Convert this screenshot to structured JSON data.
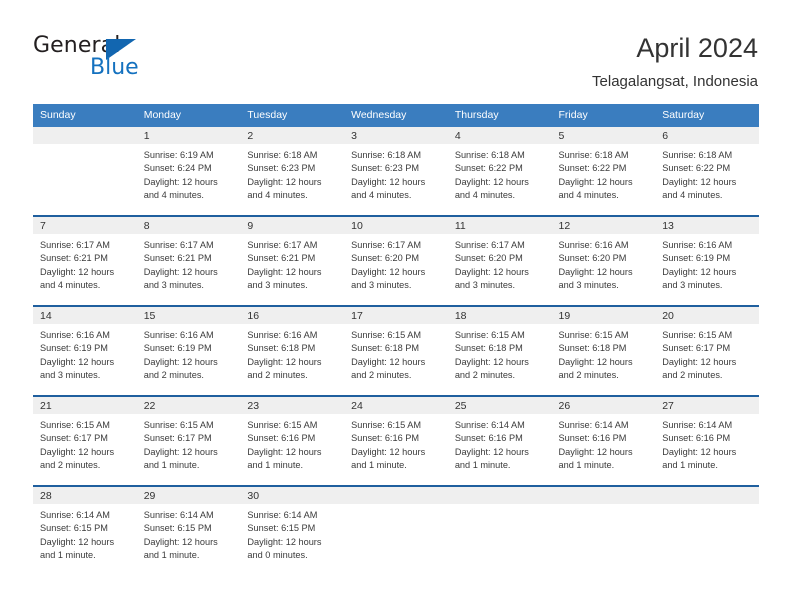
{
  "brand": {
    "name_part1": "General",
    "name_part2": "Blue",
    "triangle_color": "#1266b0",
    "blue_color": "#1471bf"
  },
  "header": {
    "title": "April 2024",
    "subtitle": "Telagalangsat, Indonesia"
  },
  "theme": {
    "header_row_bg": "#3a7dbf",
    "row_separator": "#1f5f9e",
    "daynum_strip_bg": "#efefef",
    "text": "#333333"
  },
  "weekday_headers": [
    "Sunday",
    "Monday",
    "Tuesday",
    "Wednesday",
    "Thursday",
    "Friday",
    "Saturday"
  ],
  "weeks": [
    [
      {
        "day": "",
        "sunrise": "",
        "sunset": "",
        "daylight1": "",
        "daylight2": "",
        "blank": true
      },
      {
        "day": "1",
        "sunrise": "Sunrise: 6:19 AM",
        "sunset": "Sunset: 6:24 PM",
        "daylight1": "Daylight: 12 hours",
        "daylight2": "and 4 minutes."
      },
      {
        "day": "2",
        "sunrise": "Sunrise: 6:18 AM",
        "sunset": "Sunset: 6:23 PM",
        "daylight1": "Daylight: 12 hours",
        "daylight2": "and 4 minutes."
      },
      {
        "day": "3",
        "sunrise": "Sunrise: 6:18 AM",
        "sunset": "Sunset: 6:23 PM",
        "daylight1": "Daylight: 12 hours",
        "daylight2": "and 4 minutes."
      },
      {
        "day": "4",
        "sunrise": "Sunrise: 6:18 AM",
        "sunset": "Sunset: 6:22 PM",
        "daylight1": "Daylight: 12 hours",
        "daylight2": "and 4 minutes."
      },
      {
        "day": "5",
        "sunrise": "Sunrise: 6:18 AM",
        "sunset": "Sunset: 6:22 PM",
        "daylight1": "Daylight: 12 hours",
        "daylight2": "and 4 minutes."
      },
      {
        "day": "6",
        "sunrise": "Sunrise: 6:18 AM",
        "sunset": "Sunset: 6:22 PM",
        "daylight1": "Daylight: 12 hours",
        "daylight2": "and 4 minutes."
      }
    ],
    [
      {
        "day": "7",
        "sunrise": "Sunrise: 6:17 AM",
        "sunset": "Sunset: 6:21 PM",
        "daylight1": "Daylight: 12 hours",
        "daylight2": "and 4 minutes."
      },
      {
        "day": "8",
        "sunrise": "Sunrise: 6:17 AM",
        "sunset": "Sunset: 6:21 PM",
        "daylight1": "Daylight: 12 hours",
        "daylight2": "and 3 minutes."
      },
      {
        "day": "9",
        "sunrise": "Sunrise: 6:17 AM",
        "sunset": "Sunset: 6:21 PM",
        "daylight1": "Daylight: 12 hours",
        "daylight2": "and 3 minutes."
      },
      {
        "day": "10",
        "sunrise": "Sunrise: 6:17 AM",
        "sunset": "Sunset: 6:20 PM",
        "daylight1": "Daylight: 12 hours",
        "daylight2": "and 3 minutes."
      },
      {
        "day": "11",
        "sunrise": "Sunrise: 6:17 AM",
        "sunset": "Sunset: 6:20 PM",
        "daylight1": "Daylight: 12 hours",
        "daylight2": "and 3 minutes."
      },
      {
        "day": "12",
        "sunrise": "Sunrise: 6:16 AM",
        "sunset": "Sunset: 6:20 PM",
        "daylight1": "Daylight: 12 hours",
        "daylight2": "and 3 minutes."
      },
      {
        "day": "13",
        "sunrise": "Sunrise: 6:16 AM",
        "sunset": "Sunset: 6:19 PM",
        "daylight1": "Daylight: 12 hours",
        "daylight2": "and 3 minutes."
      }
    ],
    [
      {
        "day": "14",
        "sunrise": "Sunrise: 6:16 AM",
        "sunset": "Sunset: 6:19 PM",
        "daylight1": "Daylight: 12 hours",
        "daylight2": "and 3 minutes."
      },
      {
        "day": "15",
        "sunrise": "Sunrise: 6:16 AM",
        "sunset": "Sunset: 6:19 PM",
        "daylight1": "Daylight: 12 hours",
        "daylight2": "and 2 minutes."
      },
      {
        "day": "16",
        "sunrise": "Sunrise: 6:16 AM",
        "sunset": "Sunset: 6:18 PM",
        "daylight1": "Daylight: 12 hours",
        "daylight2": "and 2 minutes."
      },
      {
        "day": "17",
        "sunrise": "Sunrise: 6:15 AM",
        "sunset": "Sunset: 6:18 PM",
        "daylight1": "Daylight: 12 hours",
        "daylight2": "and 2 minutes."
      },
      {
        "day": "18",
        "sunrise": "Sunrise: 6:15 AM",
        "sunset": "Sunset: 6:18 PM",
        "daylight1": "Daylight: 12 hours",
        "daylight2": "and 2 minutes."
      },
      {
        "day": "19",
        "sunrise": "Sunrise: 6:15 AM",
        "sunset": "Sunset: 6:18 PM",
        "daylight1": "Daylight: 12 hours",
        "daylight2": "and 2 minutes."
      },
      {
        "day": "20",
        "sunrise": "Sunrise: 6:15 AM",
        "sunset": "Sunset: 6:17 PM",
        "daylight1": "Daylight: 12 hours",
        "daylight2": "and 2 minutes."
      }
    ],
    [
      {
        "day": "21",
        "sunrise": "Sunrise: 6:15 AM",
        "sunset": "Sunset: 6:17 PM",
        "daylight1": "Daylight: 12 hours",
        "daylight2": "and 2 minutes."
      },
      {
        "day": "22",
        "sunrise": "Sunrise: 6:15 AM",
        "sunset": "Sunset: 6:17 PM",
        "daylight1": "Daylight: 12 hours",
        "daylight2": "and 1 minute."
      },
      {
        "day": "23",
        "sunrise": "Sunrise: 6:15 AM",
        "sunset": "Sunset: 6:16 PM",
        "daylight1": "Daylight: 12 hours",
        "daylight2": "and 1 minute."
      },
      {
        "day": "24",
        "sunrise": "Sunrise: 6:15 AM",
        "sunset": "Sunset: 6:16 PM",
        "daylight1": "Daylight: 12 hours",
        "daylight2": "and 1 minute."
      },
      {
        "day": "25",
        "sunrise": "Sunrise: 6:14 AM",
        "sunset": "Sunset: 6:16 PM",
        "daylight1": "Daylight: 12 hours",
        "daylight2": "and 1 minute."
      },
      {
        "day": "26",
        "sunrise": "Sunrise: 6:14 AM",
        "sunset": "Sunset: 6:16 PM",
        "daylight1": "Daylight: 12 hours",
        "daylight2": "and 1 minute."
      },
      {
        "day": "27",
        "sunrise": "Sunrise: 6:14 AM",
        "sunset": "Sunset: 6:16 PM",
        "daylight1": "Daylight: 12 hours",
        "daylight2": "and 1 minute."
      }
    ],
    [
      {
        "day": "28",
        "sunrise": "Sunrise: 6:14 AM",
        "sunset": "Sunset: 6:15 PM",
        "daylight1": "Daylight: 12 hours",
        "daylight2": "and 1 minute."
      },
      {
        "day": "29",
        "sunrise": "Sunrise: 6:14 AM",
        "sunset": "Sunset: 6:15 PM",
        "daylight1": "Daylight: 12 hours",
        "daylight2": "and 1 minute."
      },
      {
        "day": "30",
        "sunrise": "Sunrise: 6:14 AM",
        "sunset": "Sunset: 6:15 PM",
        "daylight1": "Daylight: 12 hours",
        "daylight2": "and 0 minutes."
      },
      {
        "day": "",
        "sunrise": "",
        "sunset": "",
        "daylight1": "",
        "daylight2": "",
        "blank": true
      },
      {
        "day": "",
        "sunrise": "",
        "sunset": "",
        "daylight1": "",
        "daylight2": "",
        "blank": true
      },
      {
        "day": "",
        "sunrise": "",
        "sunset": "",
        "daylight1": "",
        "daylight2": "",
        "blank": true
      },
      {
        "day": "",
        "sunrise": "",
        "sunset": "",
        "daylight1": "",
        "daylight2": "",
        "blank": true
      }
    ]
  ]
}
